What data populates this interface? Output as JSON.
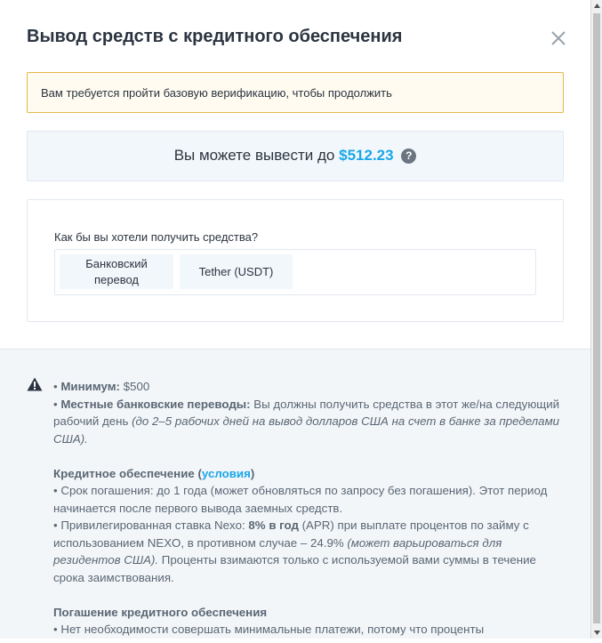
{
  "modal": {
    "title": "Вывод средств с кредитного обеспечения",
    "close_icon": "close-icon"
  },
  "warning": {
    "text": "Вам требуется пройти базовую верификацию, чтобы продолжить"
  },
  "limit": {
    "prefix": "Вы можете вывести до",
    "amount": "$512.23",
    "help": "?",
    "help_icon": "question-circle-icon"
  },
  "method": {
    "question": "Как бы вы хотели получить средства?",
    "options": [
      {
        "label_line1": "Банковский",
        "label_line2": "перевод"
      },
      {
        "label": "Tether (USDT)"
      }
    ]
  },
  "info": {
    "alert_icon": "warning-triangle-icon",
    "min_bullet": "• ",
    "min_label": "Минимум:",
    "min_value": " $500",
    "local_bullet": "• ",
    "local_label": "Местные банковские переводы:",
    "local_text": " Вы должны получить средства в этот же/на следующий рабочий день ",
    "local_note": "(до 2–5 рабочих дней на вывод долларов США на счет в банке за пределами США).",
    "credit_title": "Кредитное обеспечение (",
    "credit_link": "условия",
    "credit_title_end": ")",
    "term_text": "• Срок погашения: до 1 года (может обновляться по запросу без погашения). Этот период начинается после первого вывода заемных средств.",
    "rate_pre": "• Привилегированная ставка Nexo: ",
    "rate_value": "8% в год",
    "rate_mid": " (APR) при выплате процентов по займу с использованием NEXO, в противном случае – 24.9% ",
    "rate_note": "(может варьироваться для резидентов США).",
    "rate_end": " Проценты взимаются только с используемой вами суммы в течение срока заимствования.",
    "repay_title": "Погашение кредитного обеспечения",
    "repay_text": "• Нет необходимости совершать минимальные платежи, потому что проценты"
  },
  "colors": {
    "accent": "#1aa7e8",
    "warning_border": "#e4b84a",
    "panel_bg": "#f2f7fb"
  }
}
